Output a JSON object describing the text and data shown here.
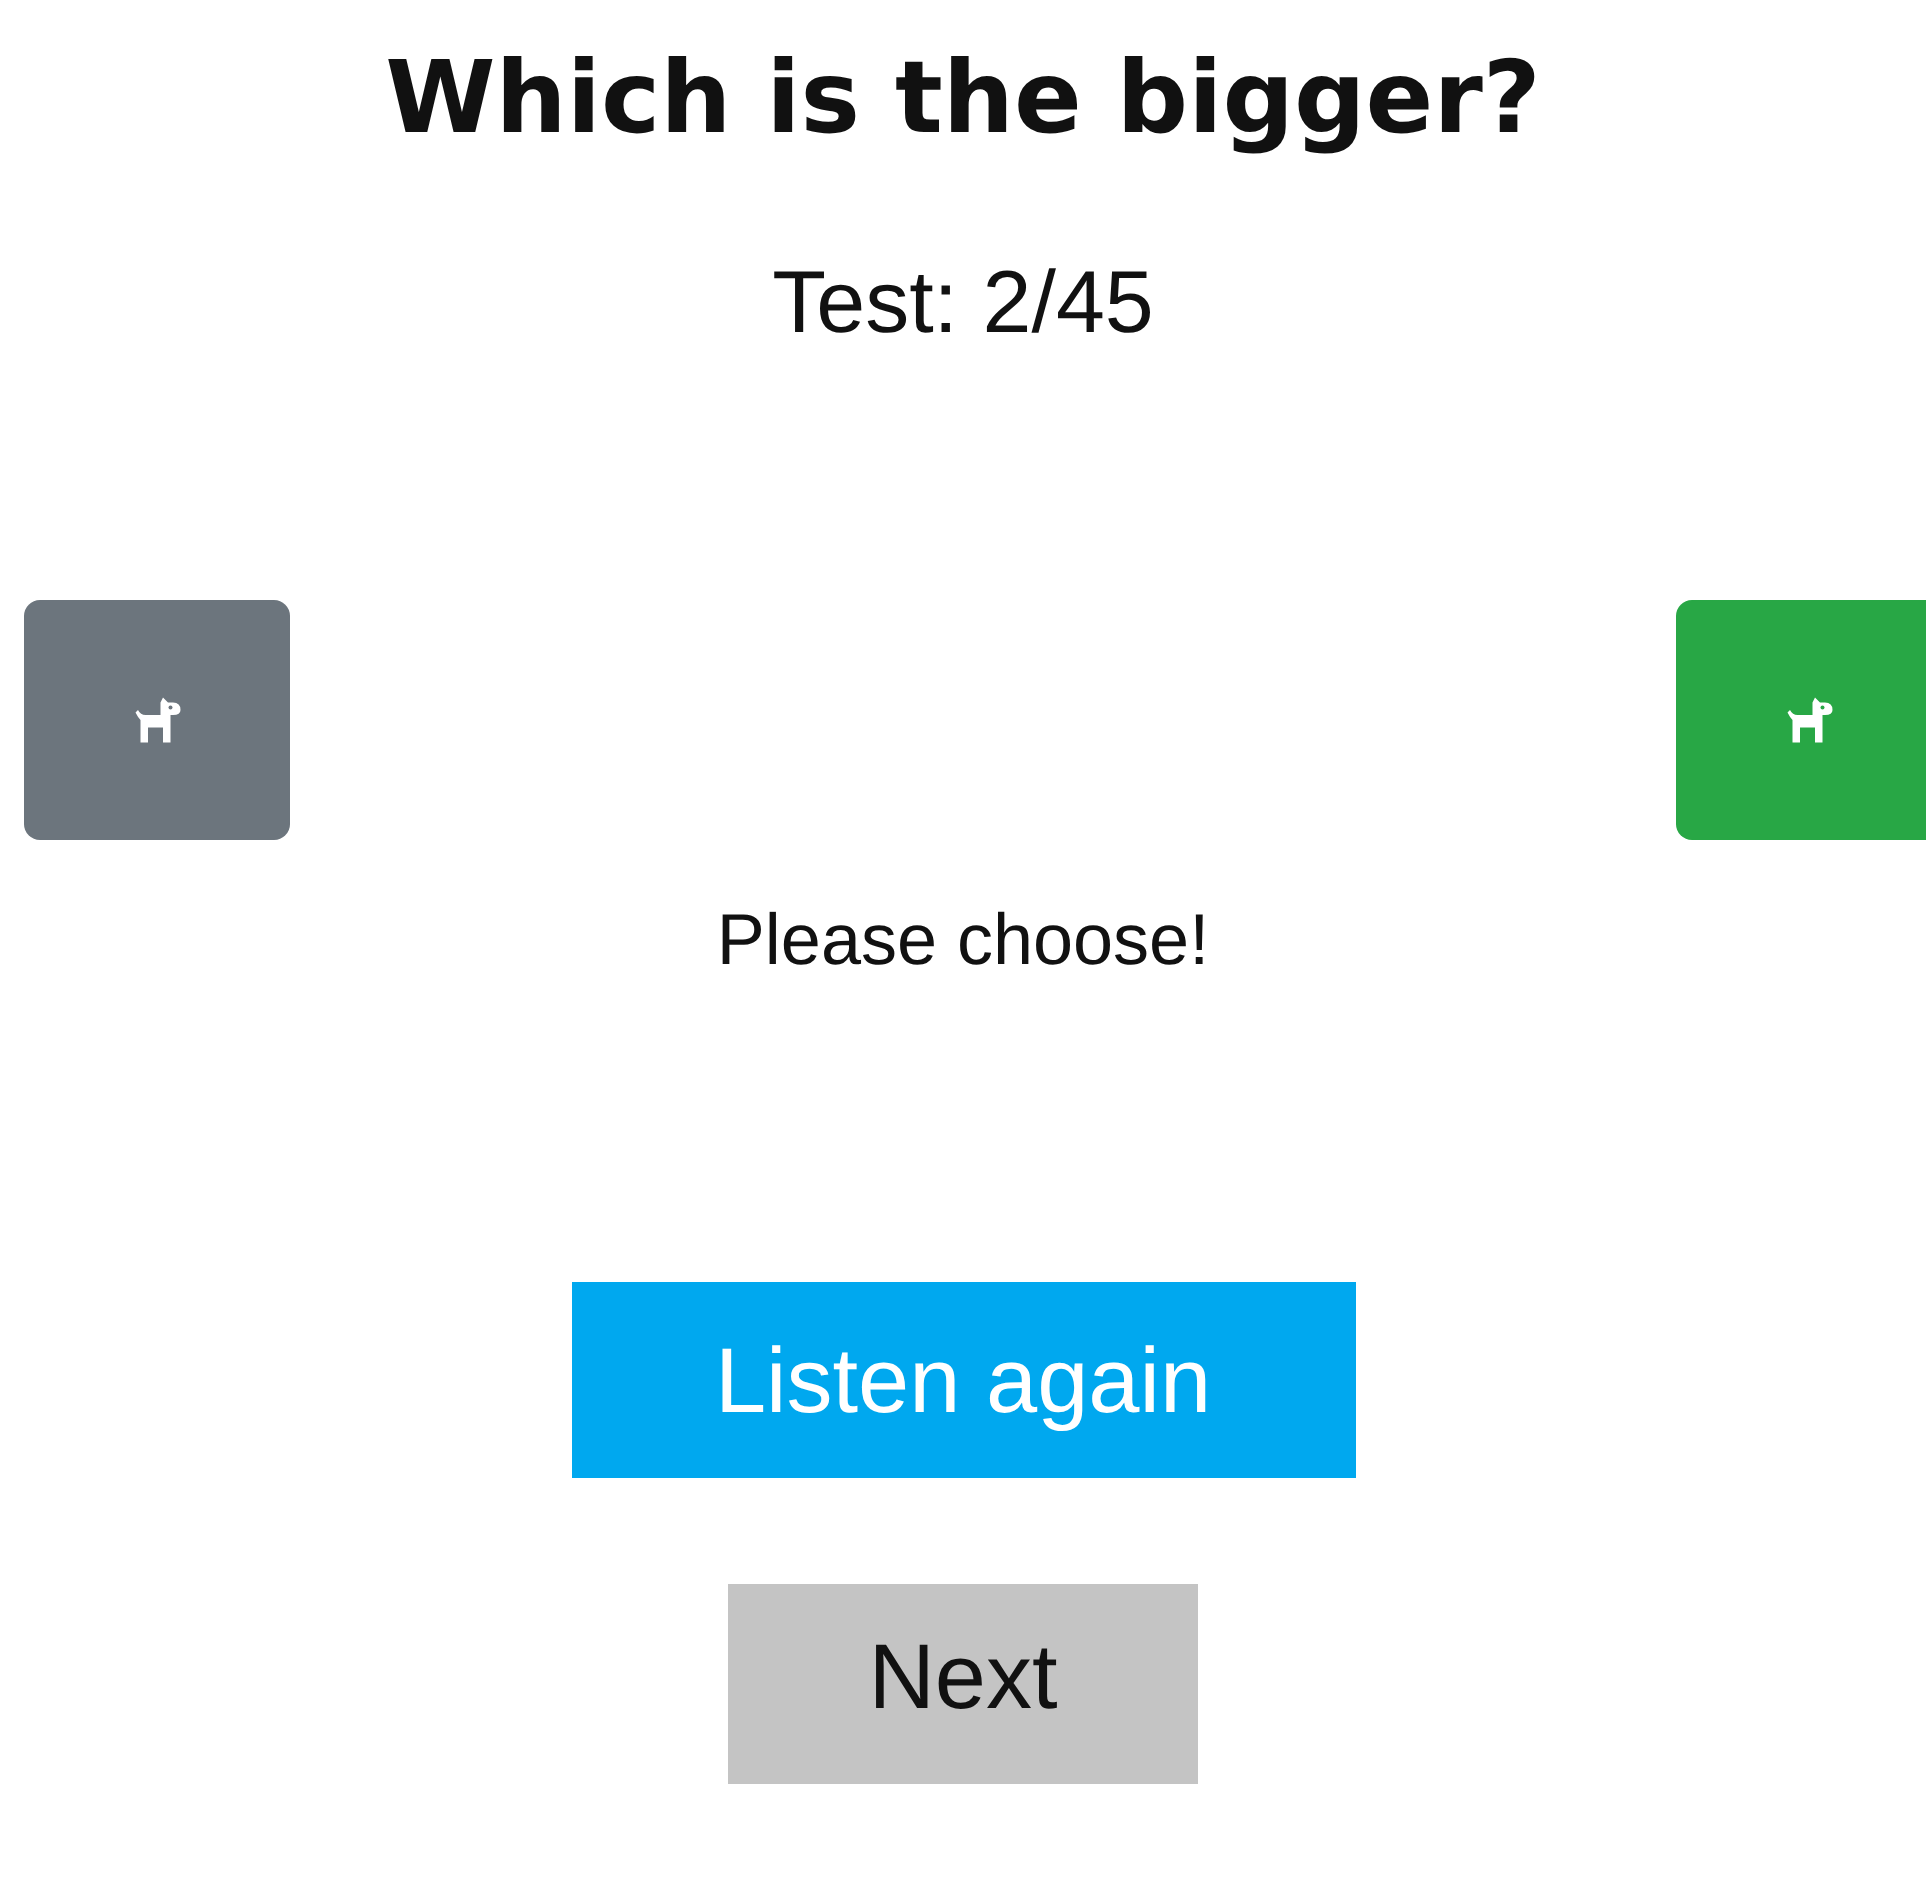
{
  "title": "Which is the bigger?",
  "progress": "Test: 2/45",
  "choices": [
    {
      "selected": false
    },
    {
      "selected": true
    }
  ],
  "prompt": "Please choose!",
  "buttons": [
    {
      "kind": "primary",
      "label": "Listen again"
    },
    {
      "kind": "secondary",
      "label": "Next"
    }
  ]
}
